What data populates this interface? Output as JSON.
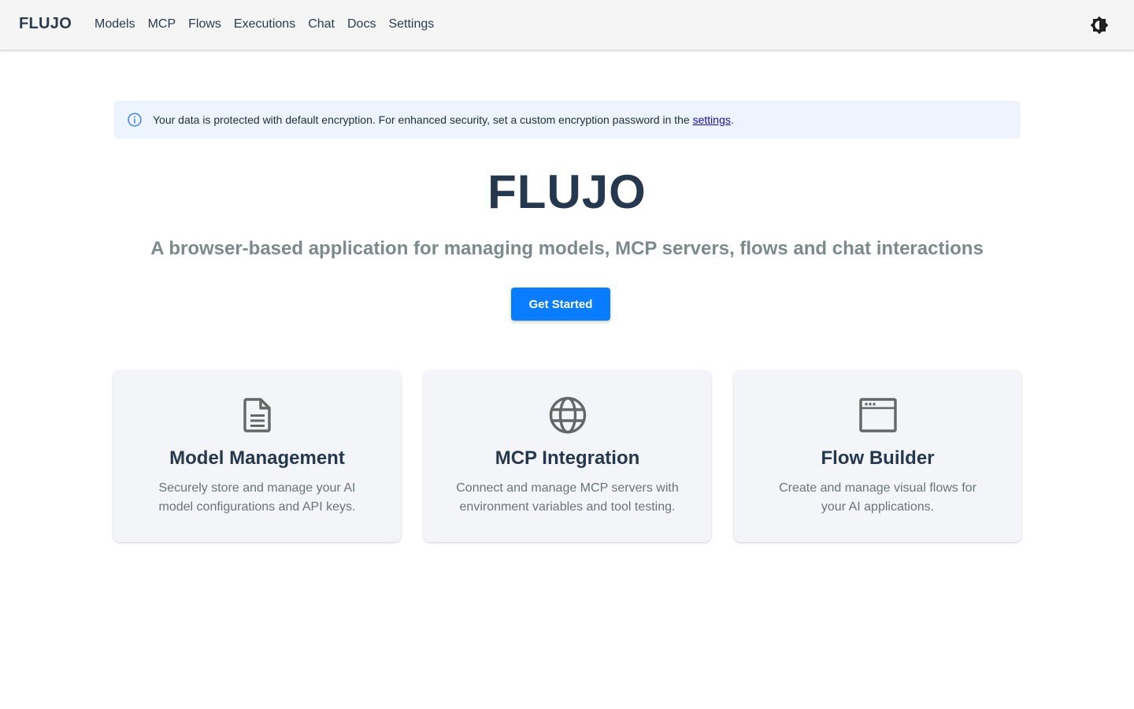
{
  "header": {
    "brand": "FLUJO",
    "nav": [
      {
        "label": "Models"
      },
      {
        "label": "MCP"
      },
      {
        "label": "Flows"
      },
      {
        "label": "Executions"
      },
      {
        "label": "Chat"
      },
      {
        "label": "Docs"
      },
      {
        "label": "Settings"
      }
    ],
    "theme_toggle_icon": "brightness-icon"
  },
  "banner": {
    "icon": "info-icon",
    "text": "Your data is protected with default encryption. For enhanced security, set a custom encryption password in the ",
    "link": "settings",
    "suffix": "."
  },
  "hero": {
    "title": "FLUJO",
    "subtitle": "A browser-based application for managing models, MCP servers, flows and chat interactions",
    "cta": "Get Started"
  },
  "features": [
    {
      "icon": "document-icon",
      "title": "Model Management",
      "desc": "Securely store and manage your AI model configurations and API keys."
    },
    {
      "icon": "globe-icon",
      "title": "MCP Integration",
      "desc": "Connect and manage MCP servers with environment variables and tool testing."
    },
    {
      "icon": "browser-window-icon",
      "title": "Flow Builder",
      "desc": "Create and manage visual flows for your AI applications."
    }
  ],
  "colors": {
    "primary": "#0a7cff",
    "banner_bg": "#eef4fd",
    "card_bg": "#f3f5f9",
    "heading": "#26384d",
    "subtitle": "#7c8a8c"
  }
}
